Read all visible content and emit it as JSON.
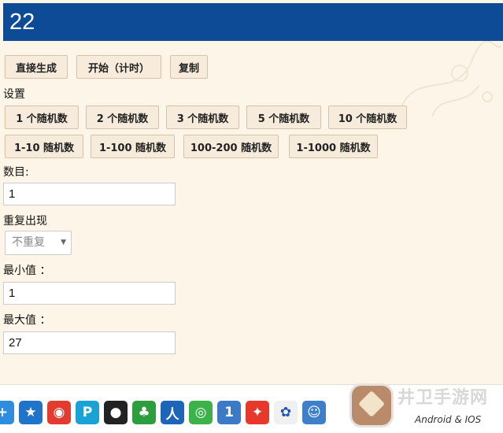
{
  "result": {
    "value": "22"
  },
  "toolbar": {
    "generate_label": "直接生成",
    "start_label": "开始（计时）",
    "copy_label": "复制"
  },
  "settings": {
    "title": "设置",
    "presets_row1": [
      "1 个随机数",
      "2 个随机数",
      "3 个随机数",
      "5 个随机数",
      "10 个随机数"
    ],
    "presets_row2": [
      "1-10 随机数",
      "1-100 随机数",
      "100-200 随机数",
      "1-1000 随机数"
    ]
  },
  "form": {
    "count_label": "数目:",
    "count_value": "1",
    "repeat_label": "重复出现",
    "repeat_selected": "不重复",
    "min_label": "最小值 ：",
    "min_value": "1",
    "max_label": "最大值 ：",
    "max_value": "27"
  },
  "taskbar": {
    "icons": [
      "plus-icon",
      "star-icon",
      "weibo-icon",
      "pp-icon",
      "qq-penguin-icon",
      "clover-icon",
      "renren-icon",
      "wechat-icon",
      "one-icon",
      "star-game-icon",
      "paw-icon",
      "person-icon"
    ]
  },
  "watermark": {
    "site": "井卫手游网",
    "platforms": "Android & IOS"
  },
  "colors": {
    "result_bg": "#0d4b97",
    "page_bg": "#fdf6e8",
    "button_bg": "#f7ecdc",
    "button_border": "#d9c2a3"
  }
}
